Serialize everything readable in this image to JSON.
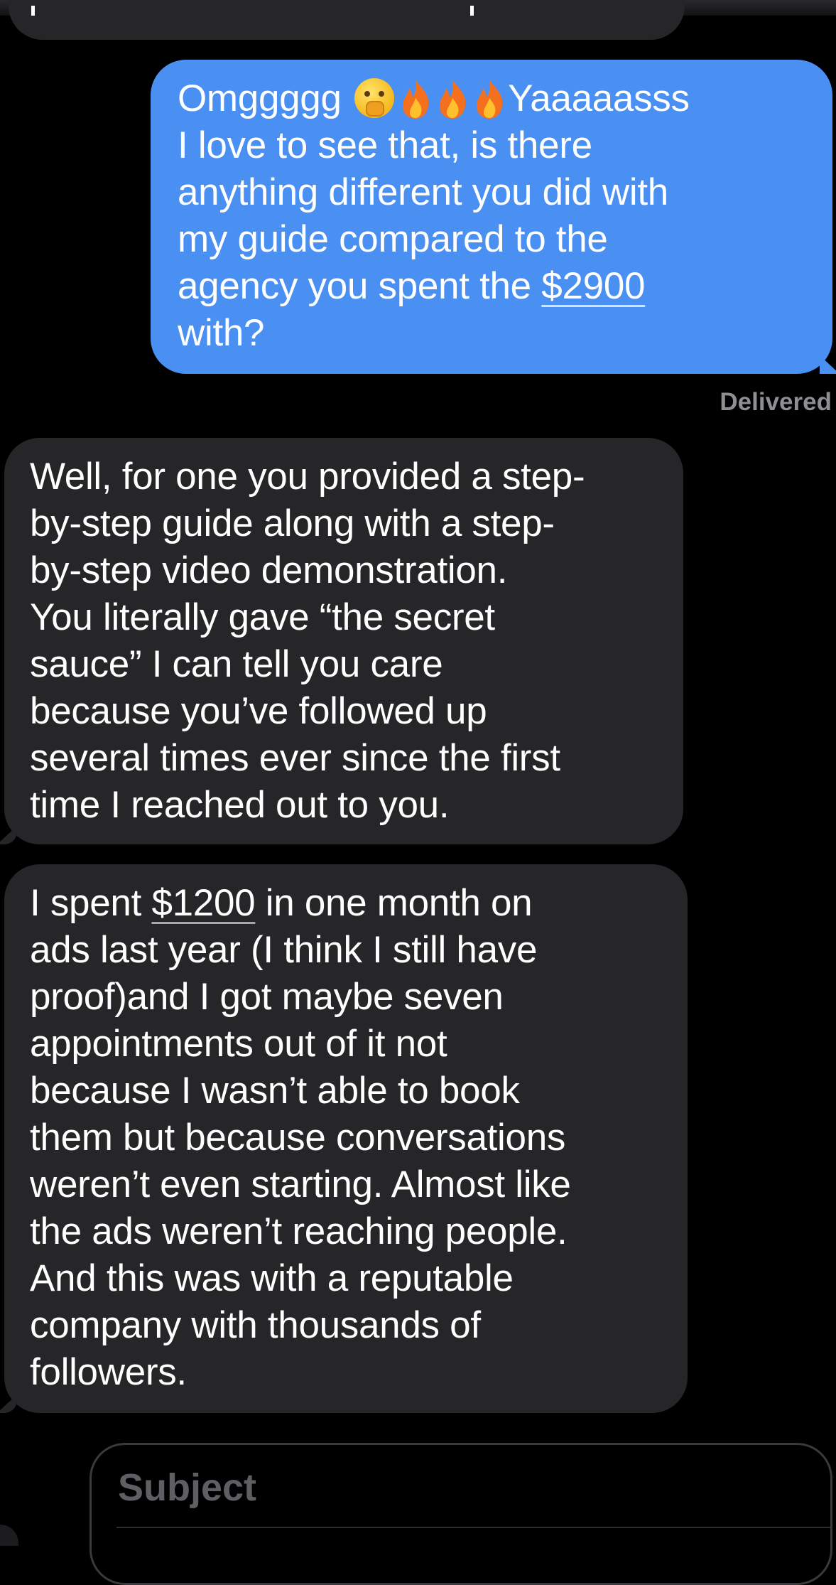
{
  "conversation": {
    "messages": [
      {
        "direction": "incoming",
        "lines": [
          "p"
        ]
      },
      {
        "direction": "outgoing",
        "lines": [
          "Omggggg",
          "Yaaaaasss",
          "I love to see that, is there",
          "anything different you did with",
          "my guide compared to the",
          "agency you spent the ",
          "$2900",
          "with?"
        ],
        "emoji": [
          "shushing-face",
          "fire",
          "fire",
          "fire"
        ],
        "status": "Delivered"
      },
      {
        "direction": "incoming",
        "lines": [
          "Well, for one you provided a step-",
          "by-step guide along with a step-",
          "by-step video demonstration.",
          "You literally gave “the secret",
          "sauce” I can tell you care",
          "because you’ve followed up",
          "several times ever since the first",
          "time I reached out to you."
        ]
      },
      {
        "direction": "incoming",
        "lines": [
          "I spent ",
          "$1200",
          " in one month on",
          "ads last year (I think I still have",
          "proof)and I got maybe seven",
          "appointments out of it not",
          "because I wasn’t able to book",
          "them but because conversations",
          "weren’t even starting. Almost like",
          "the ads weren’t reaching people.",
          "And this was with a reputable",
          "company with thousands of",
          "followers."
        ]
      }
    ]
  },
  "compose": {
    "subject_placeholder": "Subject"
  },
  "colors": {
    "background": "#000000",
    "incoming_bubble": "#262628",
    "outgoing_bubble": "#4a8ff2",
    "status_text": "#8e8e93",
    "placeholder_text": "#5e5e63"
  }
}
